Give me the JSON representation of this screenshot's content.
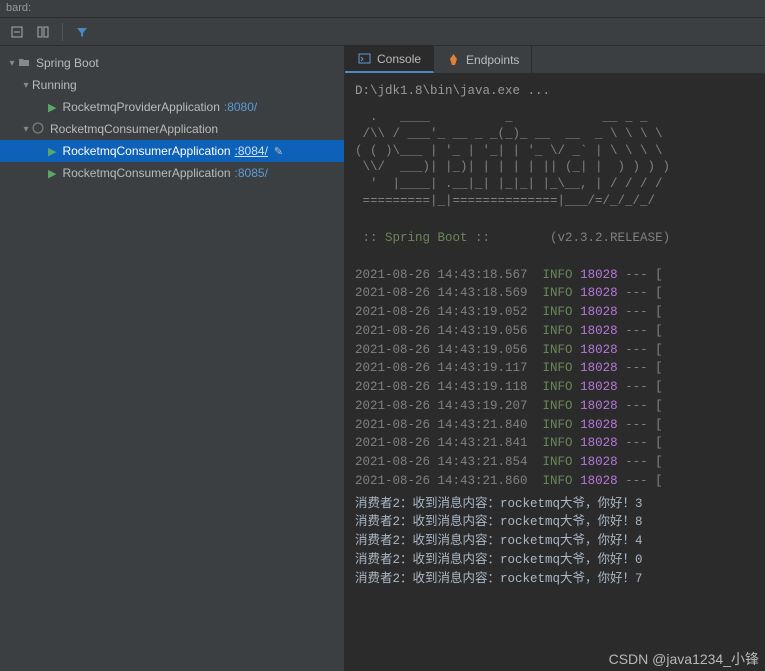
{
  "titlebar": "bard:",
  "toolbar": {
    "collapse_icon": "collapse-all-icon",
    "layout_icon": "layout-icon",
    "filter_icon": "filter-icon"
  },
  "sidebar": {
    "root_label": "Spring Boot",
    "running_label": "Running",
    "provider": {
      "name": "RocketmqProviderApplication",
      "port": ":8080/"
    },
    "consumer_group": {
      "name": "RocketmqConsumerApplication"
    },
    "consumers": [
      {
        "name": "RocketmqConsumerApplication",
        "port": ":8084/",
        "selected": true
      },
      {
        "name": "RocketmqConsumerApplication",
        "port": ":8085/",
        "selected": false
      }
    ]
  },
  "tabs": {
    "console": "Console",
    "endpoints": "Endpoints"
  },
  "console": {
    "cmd": "D:\\jdk1.8\\bin\\java.exe ...",
    "ascii": "  .   ____          _            __ _ _\n /\\\\ / ___'_ __ _ _(_)_ __  __  _ \\ \\ \\ \\\n( ( )\\___ | '_ | '_| | '_ \\/ _` | \\ \\ \\ \\\n \\\\/  ___)| |_)| | | | | || (_| |  ) ) ) )\n  '  |____| .__|_| |_|_| |_\\__, | / / / /\n =========|_|==============|___/=/_/_/_/",
    "spring_label": " :: Spring Boot :: ",
    "spring_version": "(v2.3.2.RELEASE)",
    "logs": [
      {
        "ts": "2021-08-26 14:43:18.567",
        "level": "INFO",
        "pid": "18028",
        "tail": "--- ["
      },
      {
        "ts": "2021-08-26 14:43:18.569",
        "level": "INFO",
        "pid": "18028",
        "tail": "--- ["
      },
      {
        "ts": "2021-08-26 14:43:19.052",
        "level": "INFO",
        "pid": "18028",
        "tail": "--- ["
      },
      {
        "ts": "2021-08-26 14:43:19.056",
        "level": "INFO",
        "pid": "18028",
        "tail": "--- ["
      },
      {
        "ts": "2021-08-26 14:43:19.056",
        "level": "INFO",
        "pid": "18028",
        "tail": "--- ["
      },
      {
        "ts": "2021-08-26 14:43:19.117",
        "level": "INFO",
        "pid": "18028",
        "tail": "--- ["
      },
      {
        "ts": "2021-08-26 14:43:19.118",
        "level": "INFO",
        "pid": "18028",
        "tail": "--- ["
      },
      {
        "ts": "2021-08-26 14:43:19.207",
        "level": "INFO",
        "pid": "18028",
        "tail": "--- ["
      },
      {
        "ts": "2021-08-26 14:43:21.840",
        "level": "INFO",
        "pid": "18028",
        "tail": "--- ["
      },
      {
        "ts": "2021-08-26 14:43:21.841",
        "level": "INFO",
        "pid": "18028",
        "tail": "--- ["
      },
      {
        "ts": "2021-08-26 14:43:21.854",
        "level": "INFO",
        "pid": "18028",
        "tail": "--- ["
      },
      {
        "ts": "2021-08-26 14:43:21.860",
        "level": "INFO",
        "pid": "18028",
        "tail": "--- ["
      }
    ],
    "messages": [
      "消费者2：收到消息内容：rocketmq大爷，你好！3",
      "消费者2：收到消息内容：rocketmq大爷，你好！8",
      "消费者2：收到消息内容：rocketmq大爷，你好！4",
      "消费者2：收到消息内容：rocketmq大爷，你好！0",
      "消费者2：收到消息内容：rocketmq大爷，你好！7"
    ]
  },
  "watermark": "CSDN @java1234_小锋"
}
